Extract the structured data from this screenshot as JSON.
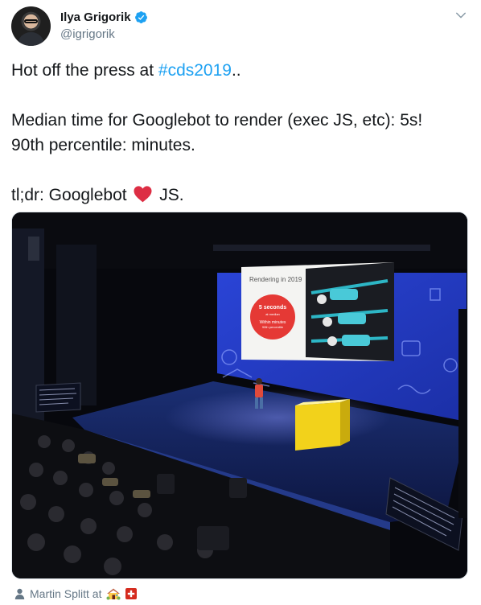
{
  "author": {
    "display_name": "Ilya Grigorik",
    "handle": "@igrigorik"
  },
  "tweet": {
    "line1_prefix": "Hot off the press at ",
    "hashtag": "#cds2019",
    "line1_suffix": "..",
    "line2": "Median time for Googlebot to render (exec JS, etc): 5s!",
    "line3": "90th percentile: minutes.",
    "line4_prefix": "tl;dr: Googlebot ",
    "line4_suffix": " JS."
  },
  "photo": {
    "slide_title": "Rendering in 2019",
    "slide_big": "5 seconds",
    "slide_small1": "at median",
    "slide_small2": "Within minutes",
    "slide_small3": "90th percentile"
  },
  "tagged": {
    "text": "Martin Splitt at"
  },
  "colors": {
    "accent": "#1da1f2",
    "muted": "#657786",
    "heart": "#e0245e",
    "slide_red": "#e53935",
    "podium_yellow": "#f2d21b"
  },
  "icons": [
    "verified-badge-icon",
    "chevron-down-icon",
    "heart-emoji-icon",
    "person-icon",
    "house-emoji-icon",
    "swiss-flag-icon"
  ]
}
